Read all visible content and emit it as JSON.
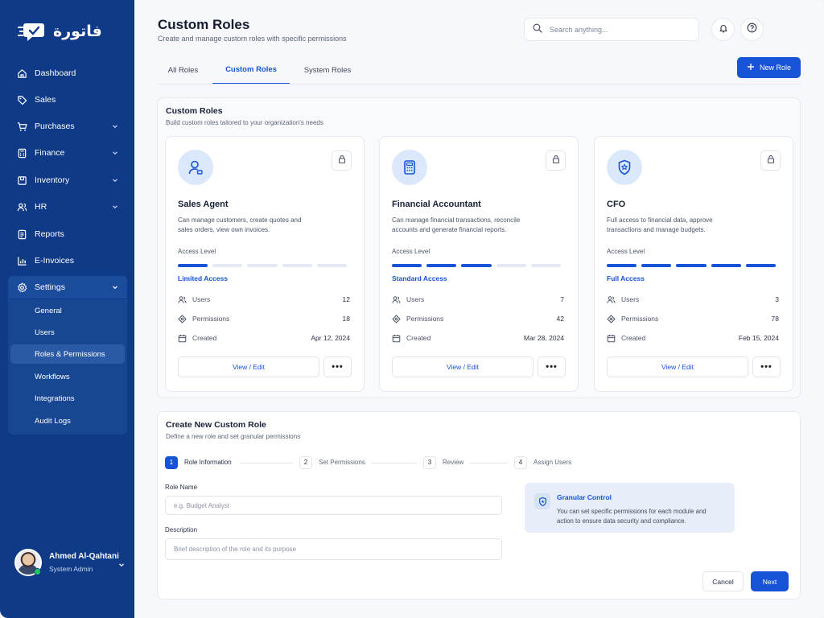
{
  "sidebar": {
    "logo_text": "فاتورة",
    "items": [
      {
        "label": "Dashboard",
        "icon": "home-icon"
      },
      {
        "label": "Sales",
        "icon": "tag-icon"
      },
      {
        "label": "Purchases",
        "icon": "cart-icon"
      },
      {
        "label": "Finance",
        "icon": "calculator-icon"
      },
      {
        "label": "Inventory",
        "icon": "box-icon"
      },
      {
        "label": "HR",
        "icon": "users-icon"
      },
      {
        "label": "Reports",
        "icon": "report-icon"
      },
      {
        "label": "E-Invoices",
        "icon": "chart-icon"
      },
      {
        "label": "Settings",
        "icon": "gear-icon"
      }
    ],
    "settings_sub": [
      "General",
      "Users",
      "Roles & Permissions",
      "Workflows",
      "Integrations",
      "Audit Logs"
    ],
    "user": {
      "name": "Ahmed Al-Qahtani",
      "role": "System Admin"
    }
  },
  "header": {
    "title": "Custom Roles",
    "subtitle": "Create and manage custom roles with specific permissions",
    "search_placeholder": "Search anything..."
  },
  "tabs": [
    "All Roles",
    "Custom Roles",
    "System Roles"
  ],
  "new_role_label": "New Role",
  "roles_panel": {
    "title": "Custom Roles",
    "subtitle": "Build custom roles tailored to your organization's needs"
  },
  "roles": [
    {
      "name": "Sales Agent",
      "description": "Can manage customers, create quotes and sales orders, view own invoices.",
      "access_label": "Access Level",
      "access_value": "Limited Access",
      "access_level": 1,
      "access_max": 5,
      "users_label": "Users",
      "users": "12",
      "permissions_label": "Permissions",
      "permissions": "18",
      "created_label": "Created",
      "created": "Apr 12, 2024",
      "view_label": "View / Edit",
      "icon": "user-icon"
    },
    {
      "name": "Financial Accountant",
      "description": "Can manage financial transactions, reconcile accounts and generate financial reports.",
      "access_label": "Access Level",
      "access_value": "Standard Access",
      "access_level": 3,
      "access_max": 5,
      "users_label": "Users",
      "users": "7",
      "permissions_label": "Permissions",
      "permissions": "42",
      "created_label": "Created",
      "created": "Mar 28, 2024",
      "view_label": "View / Edit",
      "icon": "calculator-icon"
    },
    {
      "name": "CFO",
      "description": "Full access to financial data, approve transactions and manage budgets.",
      "access_label": "Access Level",
      "access_value": "Full Access",
      "access_level": 5,
      "access_max": 5,
      "users_label": "Users",
      "users": "3",
      "permissions_label": "Permissions",
      "permissions": "78",
      "created_label": "Created",
      "created": "Feb 15, 2024",
      "view_label": "View / Edit",
      "icon": "shield-star-icon"
    }
  ],
  "create_panel": {
    "title": "Create New Custom Role",
    "subtitle": "Define a new role and set granular permissions",
    "steps": [
      {
        "num": "1",
        "label": "Role Information"
      },
      {
        "num": "2",
        "label": "Set Permissions"
      },
      {
        "num": "3",
        "label": "Review"
      },
      {
        "num": "4",
        "label": "Assign Users"
      }
    ],
    "role_name_label": "Role Name",
    "role_name_placeholder": "e.g. Budget Analyst",
    "description_label": "Description",
    "description_placeholder": "Brief description of the role and its purpose",
    "info_title": "Granular Control",
    "info_text": "You can set specific permissions for each module and action to ensure data security and compliance.",
    "cancel_label": "Cancel",
    "next_label": "Next"
  },
  "colors": {
    "accent": "#1653d6",
    "sidebar": "#0f3a87"
  }
}
